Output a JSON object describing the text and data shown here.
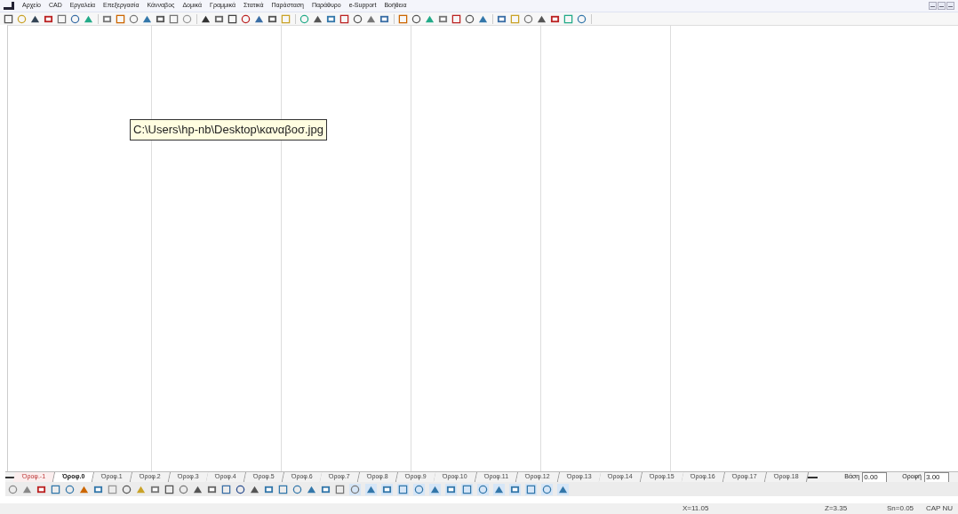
{
  "menu": [
    "Αρχείο",
    "CAD",
    "Εργαλεία",
    "Επεξεργασία",
    "Κάνναβος",
    "Δομικά",
    "Γραμμικά",
    "Στατικά",
    "Παράσταση",
    "Παράθυρο",
    "e-Support",
    "Βοήθεια"
  ],
  "tooltip": "C:\\Users\\hp-nb\\Desktop\\καναβοσ.jpg",
  "floor_tabs": [
    {
      "label": "Όροφ.-1",
      "selected": false,
      "kind": "basement"
    },
    {
      "label": "Όροφ.0",
      "selected": true,
      "kind": "floor"
    },
    {
      "label": "Όροφ.1",
      "selected": false,
      "kind": "floor"
    },
    {
      "label": "Όροφ.2",
      "selected": false,
      "kind": "floor"
    },
    {
      "label": "Όροφ.3",
      "selected": false,
      "kind": "floor"
    },
    {
      "label": "Όροφ.4",
      "selected": false,
      "kind": "floor"
    },
    {
      "label": "Όροφ.5",
      "selected": false,
      "kind": "floor"
    },
    {
      "label": "Όροφ.6",
      "selected": false,
      "kind": "floor"
    },
    {
      "label": "Όροφ.7",
      "selected": false,
      "kind": "floor"
    },
    {
      "label": "Όροφ.8",
      "selected": false,
      "kind": "floor"
    },
    {
      "label": "Όροφ.9",
      "selected": false,
      "kind": "floor"
    },
    {
      "label": "Όροφ.10",
      "selected": false,
      "kind": "floor"
    },
    {
      "label": "Όροφ.11",
      "selected": false,
      "kind": "floor"
    },
    {
      "label": "Όροφ.12",
      "selected": false,
      "kind": "floor"
    },
    {
      "label": "Όροφ.13",
      "selected": false,
      "kind": "floor"
    },
    {
      "label": "Όροφ.14",
      "selected": false,
      "kind": "floor"
    },
    {
      "label": "Όροφ.15",
      "selected": false,
      "kind": "floor"
    },
    {
      "label": "Όροφ.16",
      "selected": false,
      "kind": "floor"
    },
    {
      "label": "Όροφ.17",
      "selected": false,
      "kind": "floor"
    },
    {
      "label": "Όροφ.18",
      "selected": false,
      "kind": "floor"
    }
  ],
  "levels": [
    {
      "label": "Βάση",
      "value": "0.00"
    },
    {
      "label": "Οροφή",
      "value": "3.00"
    }
  ],
  "status_bar": [
    "X=11.05",
    "Z=3.35",
    "Sn=0.05",
    "CAP NU"
  ]
}
